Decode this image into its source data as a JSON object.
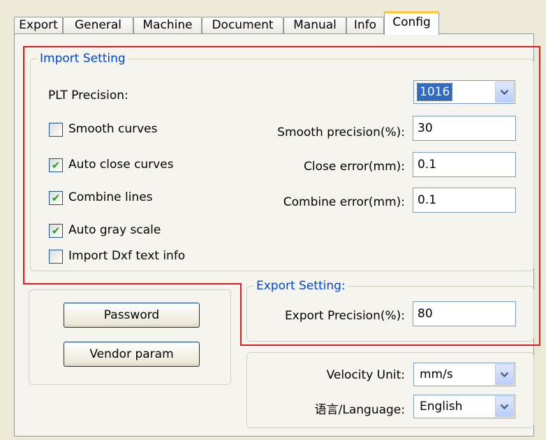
{
  "tabs": [
    "Export",
    "General",
    "Machine",
    "Document",
    "Manual",
    "Info",
    "Config"
  ],
  "active_tab": "Config",
  "import_setting": {
    "title": "Import Setting",
    "plt_precision_label": "PLT Precision:",
    "plt_precision_value": "1016",
    "smooth_curves": {
      "label": "Smooth curves",
      "checked": false
    },
    "auto_close_curves": {
      "label": "Auto close curves",
      "checked": true
    },
    "combine_lines": {
      "label": "Combine lines",
      "checked": true
    },
    "auto_gray_scale": {
      "label": "Auto gray scale",
      "checked": true
    },
    "import_dxf_text": {
      "label": "Import Dxf text info",
      "checked": false
    },
    "smooth_precision_label": "Smooth precision(%):",
    "smooth_precision_value": "30",
    "close_error_label": "Close error(mm):",
    "close_error_value": "0.1",
    "combine_error_label": "Combine error(mm):",
    "combine_error_value": "0.1"
  },
  "export_setting": {
    "title": "Export Setting:",
    "precision_label": "Export Precision(%):",
    "precision_value": "80"
  },
  "buttons": {
    "password": "Password",
    "vendor_param": "Vendor param"
  },
  "units": {
    "velocity_label": "Velocity Unit:",
    "velocity_value": "mm/s",
    "language_label": "语言/Language:",
    "language_value": "English"
  },
  "colors": {
    "highlight_outline": "#e01a1a",
    "group_title": "#0046d5",
    "check_mark": "#21a121"
  }
}
